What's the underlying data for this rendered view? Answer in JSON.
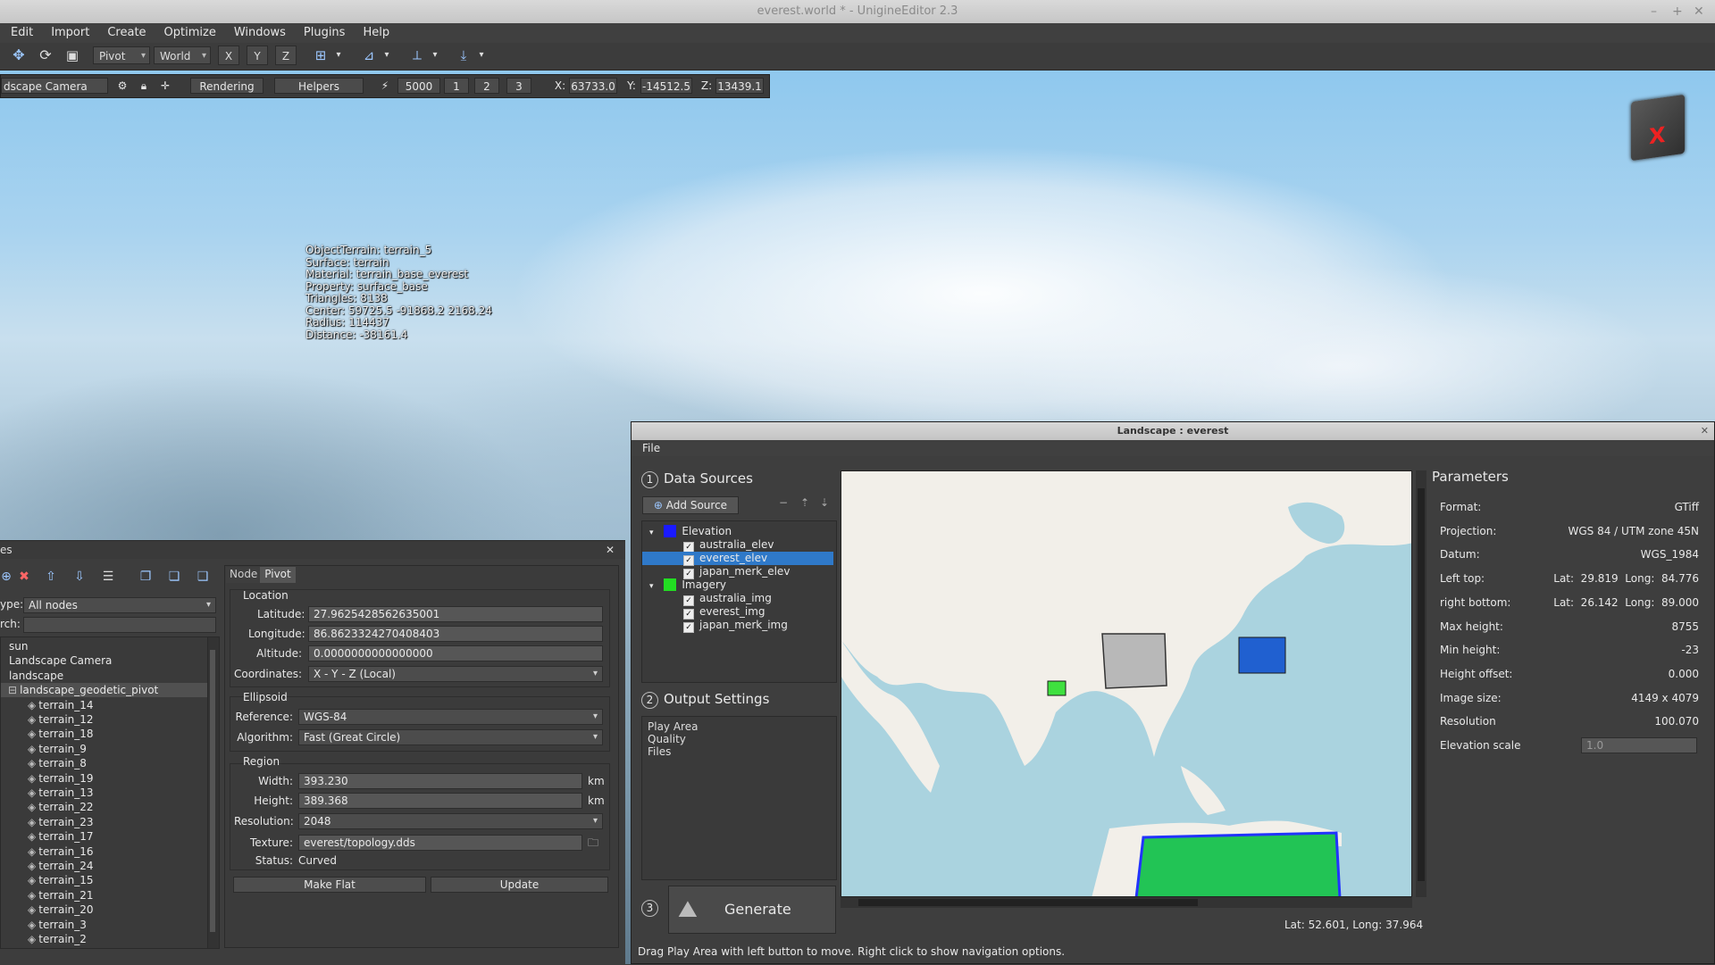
{
  "window": {
    "title": "everest.world * - UnigineEditor 2.3",
    "controls": [
      "–",
      "+",
      "✕"
    ]
  },
  "menubar": [
    "Edit",
    "Import",
    "Create",
    "Optimize",
    "Windows",
    "Plugins",
    "Help"
  ],
  "toolbar": {
    "pivot": "Pivot",
    "world": "World",
    "axis_x": "X",
    "axis_y": "Y",
    "axis_z": "Z"
  },
  "viewport_toolbar": {
    "camera": "dscape Camera",
    "rendering": "Rendering",
    "helpers": "Helpers",
    "speed": "5000",
    "preset_1": "1",
    "preset_2": "2",
    "preset_3": "3",
    "x_label": "X:",
    "x_value": "63733.0",
    "y_label": "Y:",
    "y_value": "-14512.5",
    "z_label": "Z:",
    "z_value": "13439.1"
  },
  "overlay": [
    "ObjectTerrain: terrain_5",
    "Surface: terrain",
    "Material: terrain_base_everest",
    "Property: surface_base",
    "Triangles: 8138",
    "Center: 59725.5 -91868.2 2168.24",
    "Radius: 114437",
    "Distance: -38161.4"
  ],
  "nodes_panel": {
    "title": "es",
    "close": "✕",
    "type_label": "ype:",
    "type_value": "All nodes",
    "search_label": "rch:",
    "search_value": "",
    "tree": [
      {
        "label": "sun",
        "indent": 0
      },
      {
        "label": "Landscape Camera",
        "indent": 0
      },
      {
        "label": "landscape",
        "indent": 0
      },
      {
        "label": "landscape_geodetic_pivot",
        "indent": 1,
        "selected": true
      },
      {
        "label": "terrain_14",
        "indent": 2
      },
      {
        "label": "terrain_12",
        "indent": 2
      },
      {
        "label": "terrain_18",
        "indent": 2
      },
      {
        "label": "terrain_9",
        "indent": 2
      },
      {
        "label": "terrain_8",
        "indent": 2
      },
      {
        "label": "terrain_19",
        "indent": 2
      },
      {
        "label": "terrain_13",
        "indent": 2
      },
      {
        "label": "terrain_22",
        "indent": 2
      },
      {
        "label": "terrain_23",
        "indent": 2
      },
      {
        "label": "terrain_17",
        "indent": 2
      },
      {
        "label": "terrain_16",
        "indent": 2
      },
      {
        "label": "terrain_24",
        "indent": 2
      },
      {
        "label": "terrain_15",
        "indent": 2
      },
      {
        "label": "terrain_21",
        "indent": 2
      },
      {
        "label": "terrain_20",
        "indent": 2
      },
      {
        "label": "terrain_3",
        "indent": 2
      },
      {
        "label": "terrain_2",
        "indent": 2
      }
    ]
  },
  "props": {
    "tab_node": "Node",
    "tab_pivot": "Pivot",
    "location": "Location",
    "latitude_label": "Latitude:",
    "latitude": "27.9625428562635001",
    "longitude_label": "Longitude:",
    "longitude": "86.8623324270408403",
    "altitude_label": "Altitude:",
    "altitude": "0.0000000000000000",
    "coords_label": "Coordinates:",
    "coords": "X - Y - Z (Local)",
    "ellipsoid": "Ellipsoid",
    "reference_label": "Reference:",
    "reference": "WGS-84",
    "algorithm_label": "Algorithm:",
    "algorithm": "Fast (Great Circle)",
    "region": "Region",
    "width_label": "Width:",
    "width": "393.230",
    "width_unit": "km",
    "height_label": "Height:",
    "height": "389.368",
    "height_unit": "km",
    "resolution_label": "Resolution:",
    "resolution": "2048",
    "texture_label": "Texture:",
    "texture": "everest/topology.dds",
    "status_label": "Status:",
    "status": "Curved",
    "make_flat": "Make Flat",
    "update": "Update"
  },
  "landscape": {
    "title": "Landscape : everest",
    "close": "✕",
    "menu_file": "File",
    "step1": "1",
    "data_sources": "Data Sources",
    "add_source": "Add Source",
    "elevation": "Elevation",
    "elev_items": [
      "australia_elev",
      "everest_elev",
      "japan_merk_elev"
    ],
    "imagery": "Imagery",
    "img_items": [
      "australia_img",
      "everest_img",
      "japan_merk_img"
    ],
    "step2": "2",
    "output_settings": "Output Settings",
    "output_items": [
      "Play Area",
      "Quality",
      "Files"
    ],
    "step3": "3",
    "generate": "Generate",
    "status_text": "Drag Play Area with left button to move. Right click to show navigation options.",
    "coords_readout": "Lat: 52.601, Long: 37.964",
    "elevation_color": "#1a1aff",
    "imagery_color": "#22dd22"
  },
  "parameters": {
    "title": "Parameters",
    "rows": [
      {
        "k": "Format:",
        "v": "GTiff"
      },
      {
        "k": "Projection:",
        "v": "WGS 84 / UTM zone 45N"
      },
      {
        "k": "Datum:",
        "v": "WGS_1984"
      },
      {
        "k": "Left top:",
        "v": "Lat:  29.819  Long:  84.776"
      },
      {
        "k": "right bottom:",
        "v": "Lat:  26.142  Long:  89.000"
      },
      {
        "k": "Max height:",
        "v": "8755"
      },
      {
        "k": "Min height:",
        "v": "-23"
      },
      {
        "k": "Height offset:",
        "v": "0.000"
      },
      {
        "k": "Image size:",
        "v": "4149 x 4079"
      },
      {
        "k": "Resolution",
        "v": "100.070"
      }
    ],
    "elevation_scale_label": "Elevation scale",
    "elevation_scale": "1.0"
  }
}
